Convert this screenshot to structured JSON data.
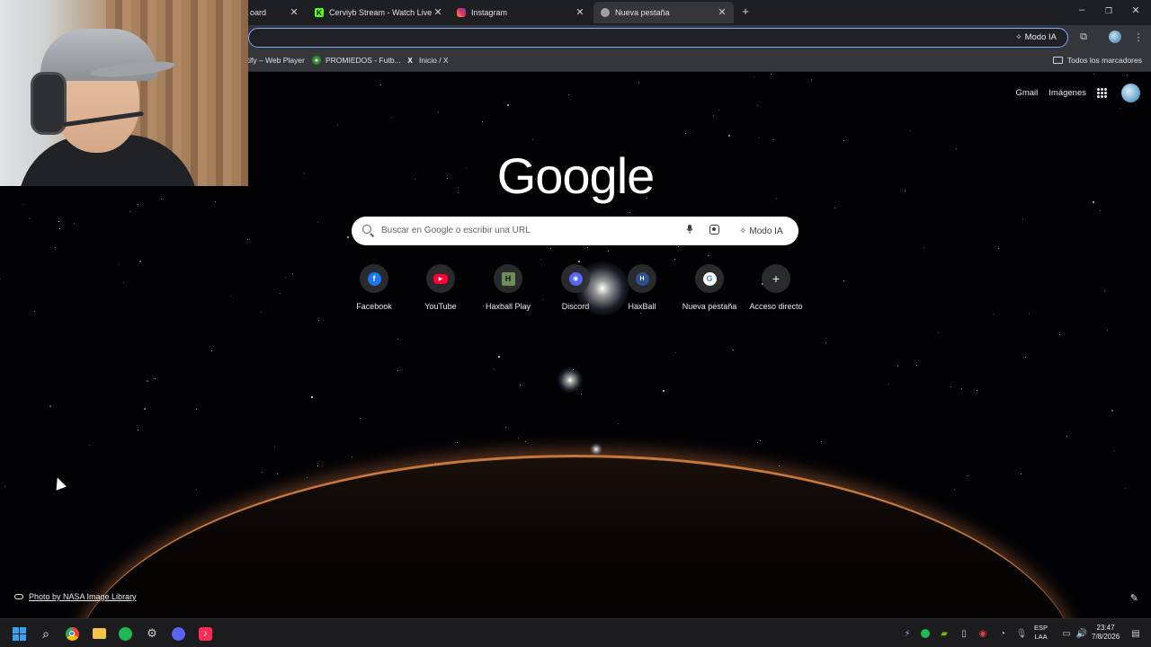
{
  "tabs": [
    {
      "title": "oard",
      "active": false
    },
    {
      "title": "Cerviyb Stream - Watch Live on",
      "active": false
    },
    {
      "title": "Instagram",
      "active": false
    },
    {
      "title": "Nueva pestaña",
      "active": true
    }
  ],
  "toolbar": {
    "omnibox_value": "",
    "modo_ia_label": "Modo IA"
  },
  "bookmarks": {
    "items": [
      {
        "label": "otify – Web Player"
      },
      {
        "label": "PROMIEDOS - Futb..."
      },
      {
        "label": "Inicio / X"
      }
    ],
    "all_label": "Todos los marcadores"
  },
  "ntp": {
    "top_links": {
      "gmail": "Gmail",
      "images": "Imágenes"
    },
    "logo": "Google",
    "search_placeholder": "Buscar en Google o escribir una URL",
    "modo_ia_label": "Modo IA",
    "shortcuts": [
      {
        "label": "Facebook",
        "icon": "facebook-icon",
        "color": "#1877f2"
      },
      {
        "label": "YouTube",
        "icon": "youtube-icon",
        "color": "#ff0033"
      },
      {
        "label": "Haxball Play",
        "icon": "haxball-play-icon",
        "color": "#6b8f5a"
      },
      {
        "label": "Discord",
        "icon": "discord-icon",
        "color": "#5865f2"
      },
      {
        "label": "HaxBall",
        "icon": "haxball-icon",
        "color": "#2f4f8f"
      },
      {
        "label": "Nueva pestaña",
        "icon": "google-icon",
        "color": "#ffffff"
      },
      {
        "label": "Acceso directo",
        "icon": "plus-icon",
        "color": "#303134"
      }
    ],
    "photo_credit": "Photo by NASA Image Library"
  },
  "taskbar": {
    "lang_1": "ESP",
    "lang_2": "LAA",
    "time": "23:47",
    "date": "7/8/2026"
  },
  "colors": {
    "accent": "#7cacf8",
    "tabbar": "#1e1f22",
    "toolbar": "#35363a"
  }
}
